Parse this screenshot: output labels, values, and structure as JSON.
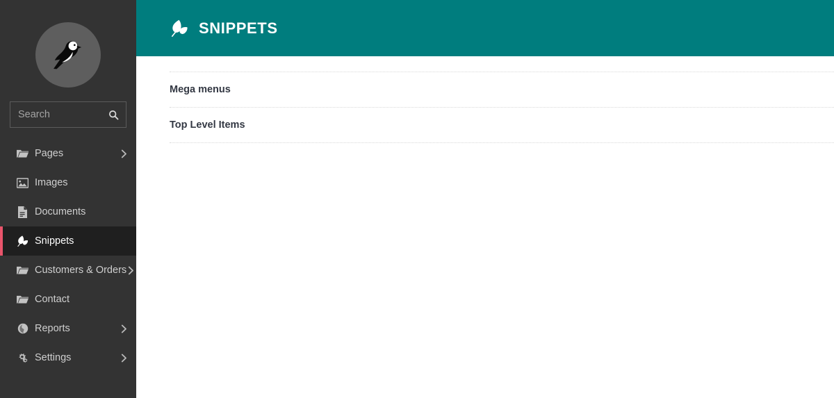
{
  "sidebar": {
    "logo": {
      "icon": "wagtail-bird-logo",
      "alt": "Wagtail"
    },
    "search": {
      "placeholder": "Search",
      "value": "",
      "icon": "search-icon"
    },
    "items": [
      {
        "label": "Pages",
        "icon": "folder-open-icon",
        "has_chevron": true,
        "chevron": "›",
        "active": false
      },
      {
        "label": "Images",
        "icon": "image-icon",
        "has_chevron": false,
        "chevron": "",
        "active": false
      },
      {
        "label": "Documents",
        "icon": "document-icon",
        "has_chevron": false,
        "chevron": "",
        "active": false
      },
      {
        "label": "Snippets",
        "icon": "snippet-leaf-icon",
        "has_chevron": false,
        "chevron": "",
        "active": true
      },
      {
        "label": "Customers & Orders",
        "icon": "folder-open-icon",
        "has_chevron": true,
        "chevron": "›",
        "active": false
      },
      {
        "label": "Contact",
        "icon": "folder-open-icon",
        "has_chevron": false,
        "chevron": "",
        "active": false
      },
      {
        "label": "Reports",
        "icon": "globe-icon",
        "has_chevron": true,
        "chevron": "›",
        "active": false
      },
      {
        "label": "Settings",
        "icon": "gears-icon",
        "has_chevron": true,
        "chevron": "›",
        "active": false
      }
    ]
  },
  "header": {
    "title": "SNIPPETS",
    "icon": "snippet-leaf-icon"
  },
  "main": {
    "snippets": [
      {
        "label": "Mega menus"
      },
      {
        "label": "Top Level Items"
      }
    ]
  },
  "colors": {
    "sidebar_bg": "#333333",
    "sidebar_active_bg": "#1f1f1f",
    "active_indicator": "#e9546b",
    "header_teal": "#007d7e",
    "content_bg": "#ffffff",
    "link_text": "#333843",
    "divider": "#d8d8d8"
  }
}
